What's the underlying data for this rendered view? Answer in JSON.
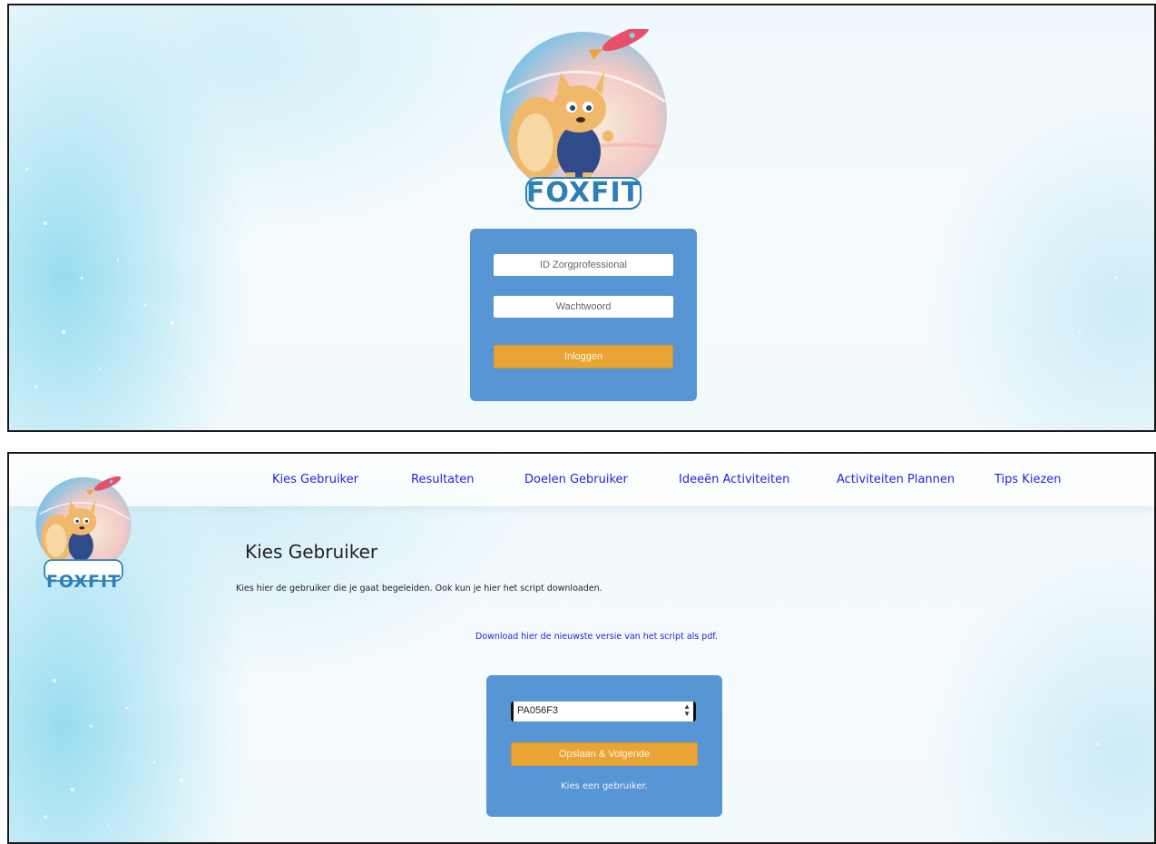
{
  "login": {
    "logo_text": "FOXFIT",
    "id_placeholder": "ID Zorgprofessional",
    "password_placeholder": "Wachtwoord",
    "login_button": "Inloggen"
  },
  "app": {
    "logo_text": "FOXFIT",
    "nav": [
      {
        "label": "Kies Gebruiker"
      },
      {
        "label": "Resultaten"
      },
      {
        "label": "Doelen Gebruiker"
      },
      {
        "label": "Ideeën Activiteiten"
      },
      {
        "label": "Activiteiten Plannen"
      },
      {
        "label": "Tips Kiezen"
      }
    ],
    "page_title": "Kies Gebruiker",
    "description": "Kies hier de gebruiker die je gaat begeleiden. Ook kun je hier het script downloaden.",
    "download_link": "Download hier de nieuwste versie van het script als pdf.",
    "user_select_value": "PA056F3",
    "save_button": "Opslaan & Volgende",
    "hint": "Kies een gebruiker."
  },
  "colors": {
    "card_blue": "#5795d4",
    "button_orange": "#e8a535",
    "link_blue": "#2222dd",
    "logo_blue": "#2d7fb8"
  }
}
